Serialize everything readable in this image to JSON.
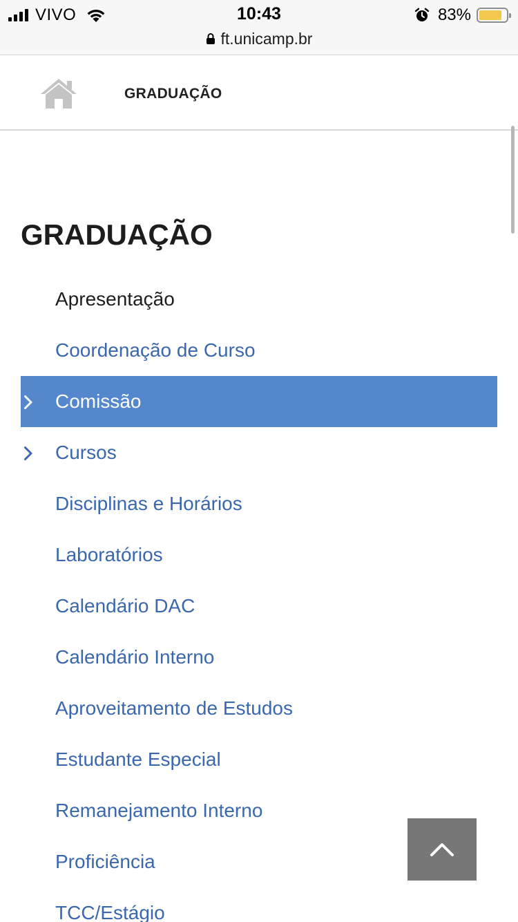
{
  "status_bar": {
    "carrier": "VIVO",
    "time": "10:43",
    "battery_percent": "83%",
    "battery_level": 0.83,
    "icons": [
      "signal-icon",
      "wifi-icon",
      "alarm-icon",
      "battery-icon"
    ]
  },
  "browser": {
    "url": "ft.unicamp.br",
    "secure_icon": "lock-icon"
  },
  "header": {
    "home_icon": "home-icon",
    "title": "GRADUAÇÃO"
  },
  "section": {
    "title": "GRADUAÇÃO"
  },
  "menu": {
    "items": [
      {
        "label": "Apresentação",
        "state": "current"
      },
      {
        "label": "Coordenação de Curso"
      },
      {
        "label": "Comissão",
        "state": "highlighted",
        "has_submenu": true
      },
      {
        "label": "Cursos",
        "has_submenu": true
      },
      {
        "label": "Disciplinas e Horários"
      },
      {
        "label": "Laboratórios"
      },
      {
        "label": "Calendário DAC"
      },
      {
        "label": "Calendário Interno"
      },
      {
        "label": "Aproveitamento de Estudos"
      },
      {
        "label": "Estudante Especial"
      },
      {
        "label": "Remanejamento Interno"
      },
      {
        "label": "Proficiência"
      },
      {
        "label": "TCC/Estágio"
      }
    ]
  },
  "colors": {
    "link": "#3a67ad",
    "active_bg": "#5487cc",
    "back_to_top_bg": "#777777"
  },
  "back_to_top_icon": "chevron-up-icon"
}
